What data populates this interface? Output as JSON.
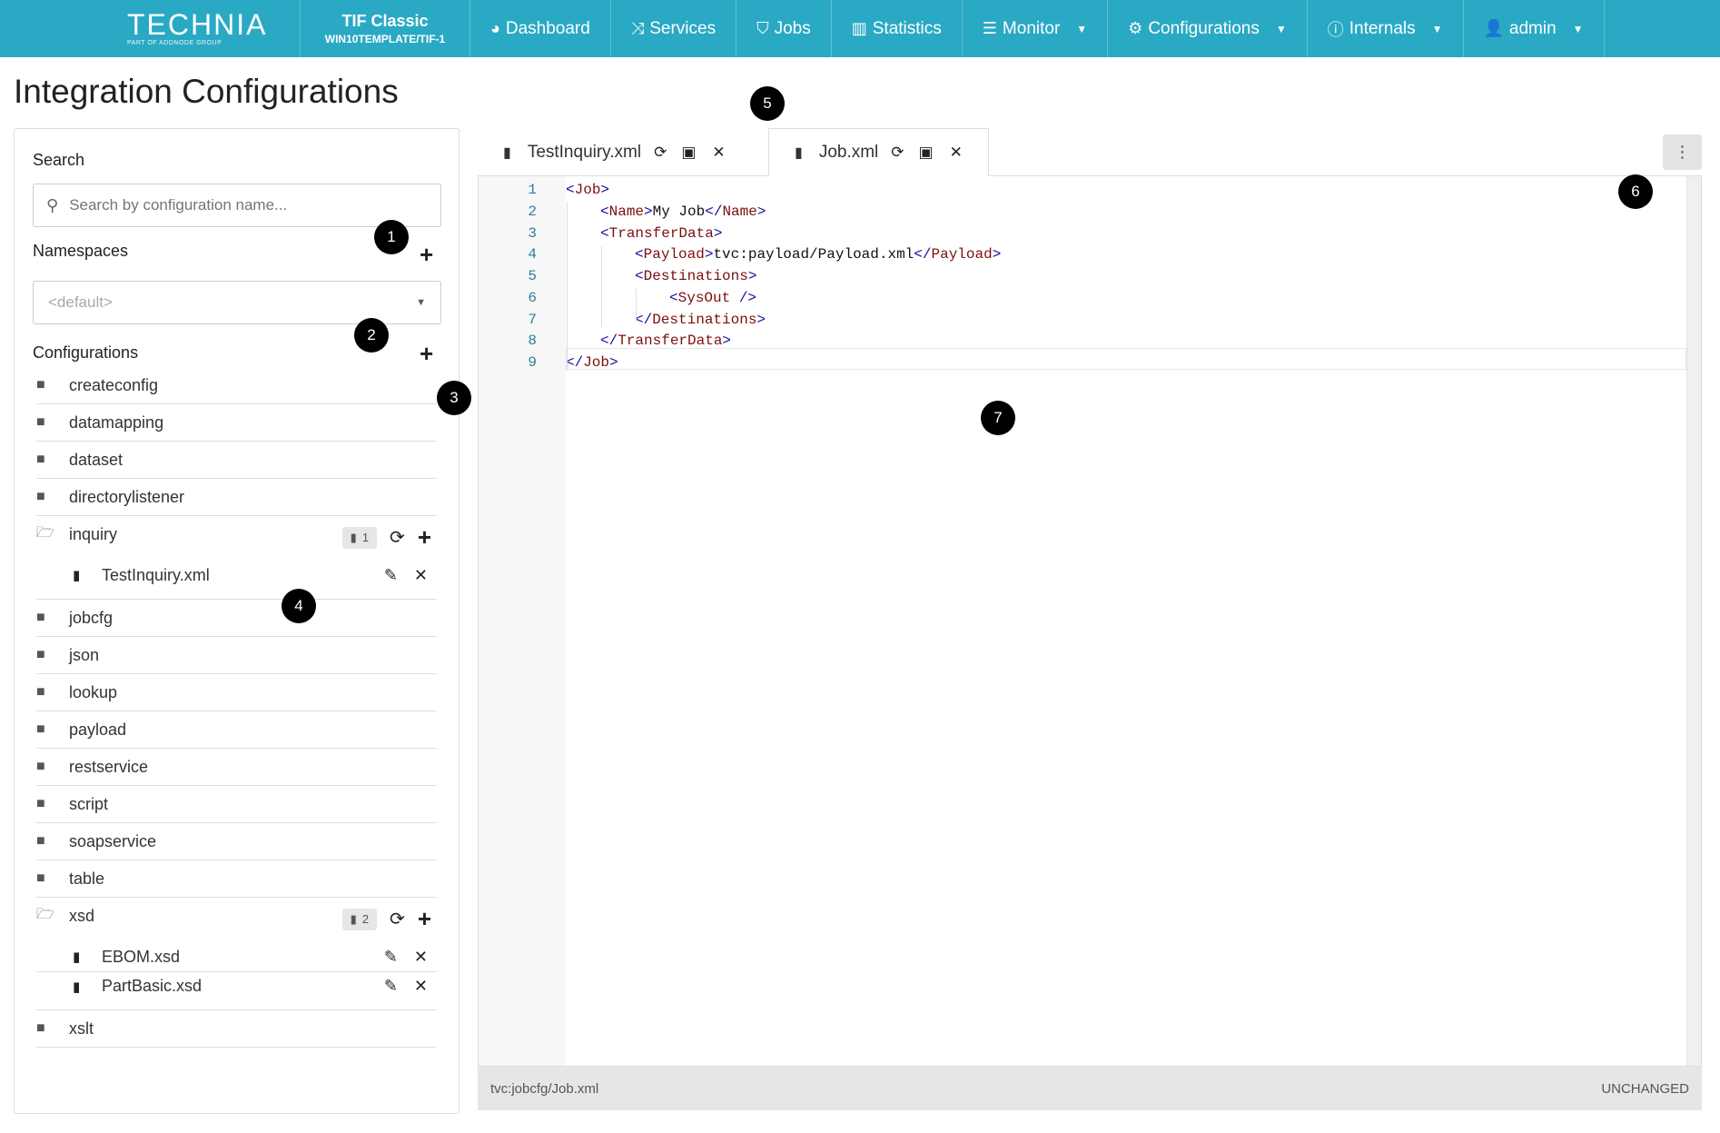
{
  "navbar": {
    "brand": {
      "logo": "TECHNIA",
      "tagline": "PART OF ADDNODE GROUP"
    },
    "instance": {
      "name": "TIF Classic",
      "host": "WIN10TEMPLATE/TIF-1"
    },
    "items": [
      {
        "label": "Dashboard",
        "icon": "dashboard-icon",
        "glyph": "◕"
      },
      {
        "label": "Services",
        "icon": "shuffle-icon",
        "glyph": "⤨"
      },
      {
        "label": "Jobs",
        "icon": "tags-icon",
        "glyph": "⛉"
      },
      {
        "label": "Statistics",
        "icon": "bar-chart-icon",
        "glyph": "▥"
      },
      {
        "label": "Monitor",
        "icon": "list-icon",
        "glyph": "☰"
      },
      {
        "label": "Configurations",
        "icon": "cogs-icon",
        "glyph": "⚙"
      },
      {
        "label": "Internals",
        "icon": "info-icon",
        "glyph": "ⓘ"
      },
      {
        "label": "admin",
        "icon": "user-icon",
        "glyph": "👤"
      }
    ]
  },
  "page": {
    "title": "Integration Configurations"
  },
  "sidebar": {
    "search_label": "Search",
    "search_placeholder": "Search by configuration name...",
    "namespaces_label": "Namespaces",
    "namespace_value": "<default>",
    "configurations_label": "Configurations",
    "folders": [
      {
        "name": "createconfig"
      },
      {
        "name": "datamapping"
      },
      {
        "name": "dataset"
      },
      {
        "name": "directorylistener"
      },
      {
        "name": "inquiry",
        "count": "1",
        "files": [
          "TestInquiry.xml"
        ]
      },
      {
        "name": "jobcfg"
      },
      {
        "name": "json"
      },
      {
        "name": "lookup"
      },
      {
        "name": "payload"
      },
      {
        "name": "restservice"
      },
      {
        "name": "script"
      },
      {
        "name": "soapservice"
      },
      {
        "name": "table"
      },
      {
        "name": "xsd",
        "count": "2",
        "files": [
          "EBOM.xsd",
          "PartBasic.xsd"
        ]
      },
      {
        "name": "xslt"
      }
    ]
  },
  "editor": {
    "tabs": [
      {
        "label": "TestInquiry.xml",
        "active": false
      },
      {
        "label": "Job.xml",
        "active": true
      }
    ],
    "lines": [
      {
        "n": "1",
        "indent": 0,
        "parts": [
          [
            "tag",
            "<"
          ],
          [
            "tname",
            "Job"
          ],
          [
            "tag",
            ">"
          ]
        ]
      },
      {
        "n": "2",
        "indent": 1,
        "parts": [
          [
            "tag",
            "<"
          ],
          [
            "tname",
            "Name"
          ],
          [
            "tag",
            ">"
          ],
          [
            "txt",
            "My Job"
          ],
          [
            "tag",
            "</"
          ],
          [
            "tname",
            "Name"
          ],
          [
            "tag",
            ">"
          ]
        ]
      },
      {
        "n": "3",
        "indent": 1,
        "parts": [
          [
            "tag",
            "<"
          ],
          [
            "tname",
            "TransferData"
          ],
          [
            "tag",
            ">"
          ]
        ]
      },
      {
        "n": "4",
        "indent": 2,
        "parts": [
          [
            "tag",
            "<"
          ],
          [
            "tname",
            "Payload"
          ],
          [
            "tag",
            ">"
          ],
          [
            "txt",
            "tvc:payload/Payload.xml"
          ],
          [
            "tag",
            "</"
          ],
          [
            "tname",
            "Payload"
          ],
          [
            "tag",
            ">"
          ]
        ]
      },
      {
        "n": "5",
        "indent": 2,
        "parts": [
          [
            "tag",
            "<"
          ],
          [
            "tname",
            "Destinations"
          ],
          [
            "tag",
            ">"
          ]
        ]
      },
      {
        "n": "6",
        "indent": 3,
        "parts": [
          [
            "tag",
            "<"
          ],
          [
            "tname",
            "SysOut"
          ],
          [
            "tag",
            " />"
          ]
        ]
      },
      {
        "n": "7",
        "indent": 2,
        "parts": [
          [
            "tag",
            "</"
          ],
          [
            "tname",
            "Destinations"
          ],
          [
            "tag",
            ">"
          ]
        ]
      },
      {
        "n": "8",
        "indent": 1,
        "parts": [
          [
            "tag",
            "</"
          ],
          [
            "tname",
            "TransferData"
          ],
          [
            "tag",
            ">"
          ]
        ]
      },
      {
        "n": "9",
        "indent": 0,
        "parts": [
          [
            "tag",
            "</"
          ],
          [
            "tname",
            "Job"
          ],
          [
            "tag",
            ">"
          ]
        ]
      }
    ],
    "status_path": "tvc:jobcfg/Job.xml",
    "status_state": "UNCHANGED"
  },
  "callouts": [
    "1",
    "2",
    "3",
    "4",
    "5",
    "6",
    "7"
  ]
}
